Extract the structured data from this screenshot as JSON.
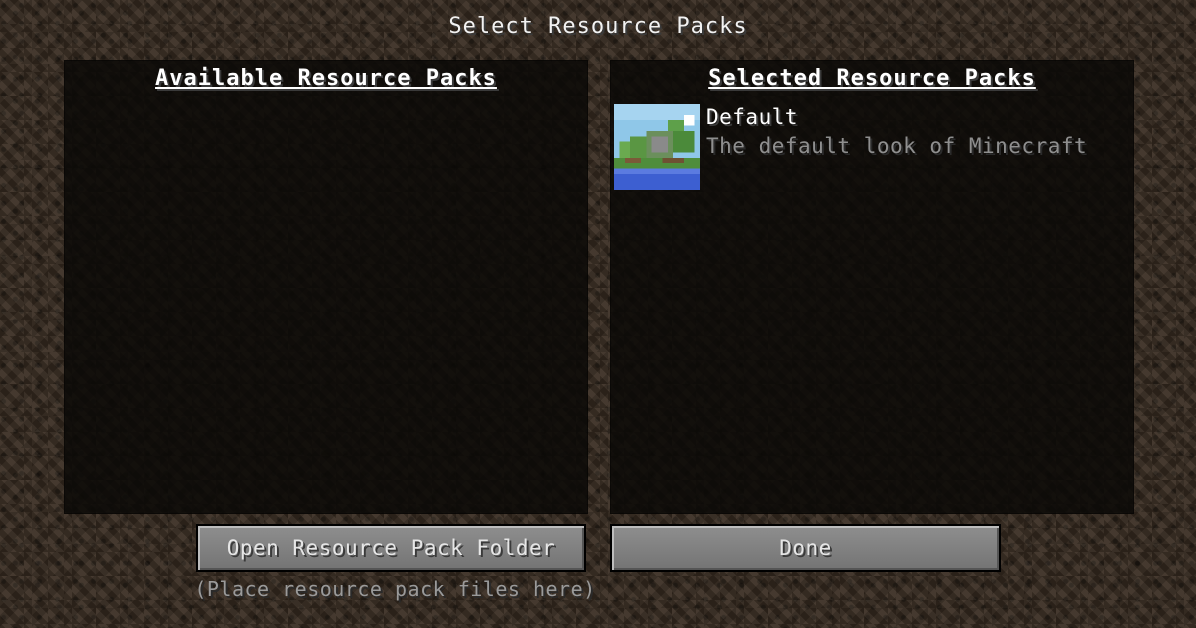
{
  "screen": {
    "title": "Select Resource Packs"
  },
  "available": {
    "header": "Available Resource Packs",
    "packs": []
  },
  "selected": {
    "header": "Selected Resource Packs",
    "packs": [
      {
        "name": "Default",
        "description": "The default look of Minecraft",
        "icon": "grass-block-landscape-icon"
      }
    ]
  },
  "buttons": {
    "open_folder_label": "Open Resource Pack Folder",
    "done_label": "Done"
  },
  "hint": "(Place resource pack files here)",
  "colors": {
    "text_primary": "#ffffff",
    "text_secondary": "#8f8f8f",
    "button_face": "#7f7f7f",
    "panel_bg": "#0a0806"
  }
}
